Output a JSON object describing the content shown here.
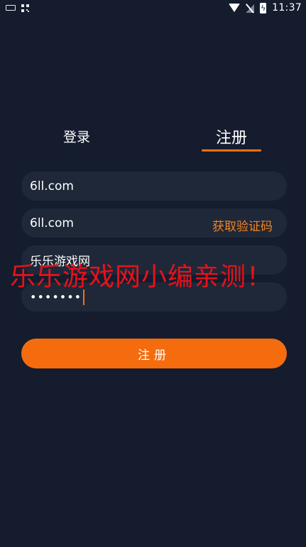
{
  "status_bar": {
    "time": "11:37",
    "icons": [
      "keyboard-icon",
      "qr-icon",
      "wifi-icon",
      "no-signal-icon",
      "battery-charging-icon"
    ]
  },
  "tabs": [
    {
      "label": "登录",
      "active": false
    },
    {
      "label": "注册",
      "active": true
    }
  ],
  "form": {
    "phone_value": "6ll.com",
    "code_value": "6ll.com",
    "get_code_label": "获取验证码",
    "nickname_value": "乐乐游戏网",
    "password_value": "•••••••",
    "submit_label": "注册"
  },
  "watermark": "乐乐游戏网小编亲测！",
  "colors": {
    "background": "#141c2e",
    "field": "#1f2838",
    "accent": "#f56c0e",
    "watermark": "#e8121a"
  }
}
